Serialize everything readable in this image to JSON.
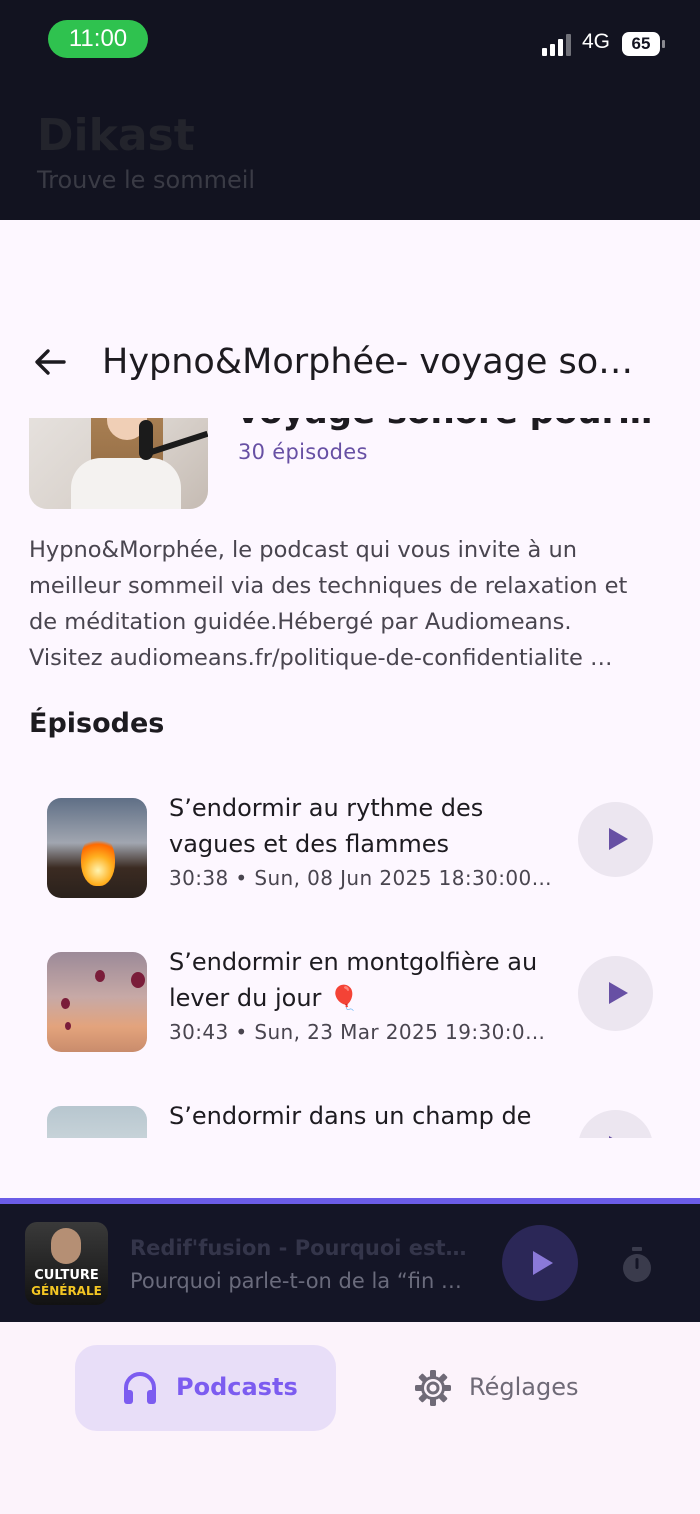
{
  "status_bar": {
    "time": "11:00",
    "network": "4G",
    "battery": "65"
  },
  "app": {
    "title": "Dikast",
    "subtitle": "Trouve le sommeil"
  },
  "podcast": {
    "title": "Hypno&Morphée- voyage so…",
    "title_partial": "voyage sonore pour…",
    "episode_count": "30 épisodes",
    "description": [
      "Hypno&Morphée, le podcast qui vous invite à un",
      "meilleur sommeil via des techniques de relaxation et",
      "de méditation guidée.Hébergé par Audiomeans.",
      "Visitez audiomeans.fr/politique-de-confidentialite …"
    ]
  },
  "episodes_section": "Épisodes",
  "episodes": [
    {
      "title": "S’endormir au rythme des vagues et des flammes",
      "meta": "30:38 • Sun, 08 Jun 2025 18:30:00…"
    },
    {
      "title": "S’endormir en montgolfière au lever du jour 🎈",
      "meta": "30:43 • Sun, 23 Mar 2025 19:30:0…"
    },
    {
      "title": "S’endormir dans un champ de",
      "meta": ""
    }
  ],
  "mini_player": {
    "title": "Redif'fusion - Pourquoi est…",
    "subtitle": "Pourquoi parle-t-on de la “fin …",
    "cover_line1": "CULTURE",
    "cover_line2": "GÉNÉRALE"
  },
  "nav": {
    "podcasts": "Podcasts",
    "settings": "Réglages"
  },
  "colors": {
    "accent": "#6750a4",
    "nav_active": "#7c5cf0",
    "header_bg": "#121320",
    "progress": "#6b5ce7"
  },
  "icons": [
    "back-arrow-icon",
    "play-icon",
    "timer-icon",
    "headphones-icon",
    "gear-icon",
    "signal-icon",
    "battery-icon"
  ]
}
